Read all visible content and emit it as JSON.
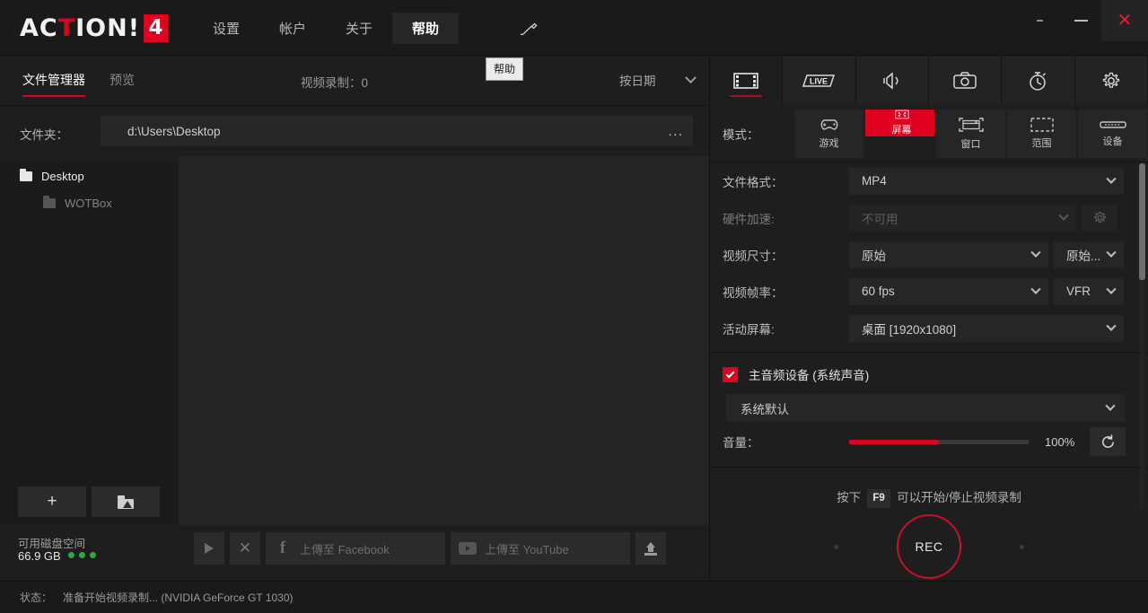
{
  "window": {
    "minimize_small": "-",
    "minimize": "—",
    "close": "✕"
  },
  "titlebar": {
    "logo_text": "ACTION!",
    "logo_number": "4",
    "nav": [
      {
        "label": "设置",
        "active": false
      },
      {
        "label": "帐户",
        "active": false
      },
      {
        "label": "关于",
        "active": false
      },
      {
        "label": "帮助",
        "active": true
      }
    ],
    "pen_icon": "pen-icon",
    "tooltip": "帮助"
  },
  "left": {
    "tabs": [
      {
        "label": "文件管理器",
        "active": true
      },
      {
        "label": "预览",
        "active": false
      }
    ],
    "recordings_count_label": "视频录制：0",
    "sort": {
      "value": "按日期"
    },
    "folder": {
      "label": "文件夹：",
      "path": "d:\\Users\\Desktop",
      "browse": "..."
    },
    "tree": [
      {
        "label": "Desktop",
        "level": 0,
        "selected": true
      },
      {
        "label": "WOTBox",
        "level": 1,
        "selected": false
      }
    ],
    "add_button": "+",
    "up_button": "up-folder-icon",
    "disk": {
      "label": "可用磁盘空间",
      "value": "66.9 GB"
    },
    "media_toolbar": {
      "play": "play-icon",
      "delete": "✕",
      "facebook_label": "上傳至 Facebook",
      "youtube_label": "上傳至 YouTube",
      "upload": "upload-icon"
    }
  },
  "statusbar": {
    "label": "状态：",
    "text": "准备开始视频录制... (NVIDIA GeForce GT 1030)"
  },
  "right": {
    "tabs": [
      {
        "icon": "film-strip-icon",
        "name": "video",
        "active": true
      },
      {
        "icon": "live-icon",
        "name": "live",
        "active": false
      },
      {
        "icon": "speaker-icon",
        "name": "audio",
        "active": false
      },
      {
        "icon": "camera-icon",
        "name": "screenshot",
        "active": false
      },
      {
        "icon": "stopwatch-icon",
        "name": "benchmark",
        "active": false
      },
      {
        "icon": "gear-icon",
        "name": "settings",
        "active": false
      }
    ],
    "mode": {
      "label": "模式：",
      "options": [
        {
          "label": "游戏",
          "icon": "gamepad-icon",
          "selected": false
        },
        {
          "label": "屏幕",
          "icon": "fullscreen-icon",
          "selected": true
        },
        {
          "label": "窗口",
          "icon": "window-icon",
          "selected": false
        },
        {
          "label": "范围",
          "icon": "region-icon",
          "selected": false
        },
        {
          "label": "设备",
          "icon": "device-icon",
          "selected": false
        }
      ]
    },
    "settings": {
      "file_format": {
        "label": "文件格式：",
        "value": "MP4"
      },
      "hw_accel": {
        "label": "硬件加速:",
        "value": "不可用",
        "disabled": true
      },
      "video_size": {
        "label": "视频尺寸：",
        "value": "原始",
        "secondary": "原始..."
      },
      "frame_rate": {
        "label": "视频帧率：",
        "value": "60 fps",
        "secondary": "VFR"
      },
      "active_screen": {
        "label": "活动屏幕:",
        "value": "桌面 [1920x1080]"
      }
    },
    "audio": {
      "checkbox_label": "主音频设备 (系统声音)",
      "checked": true,
      "device": "系统默认",
      "volume_label": "音量：",
      "volume_value": "100%",
      "volume_percent": 50,
      "reset_icon": "reset-icon"
    },
    "record": {
      "hint_prefix": "按下",
      "hint_key": "F9",
      "hint_suffix": "可以开始/停止视频录制",
      "button_label": "REC"
    }
  },
  "colors": {
    "accent_red": "#e00020",
    "rec_ring": "#c8102a",
    "bg": "#1e1e1e",
    "panel": "#1a1a1a",
    "disk_dot_green": "#2faa40"
  }
}
